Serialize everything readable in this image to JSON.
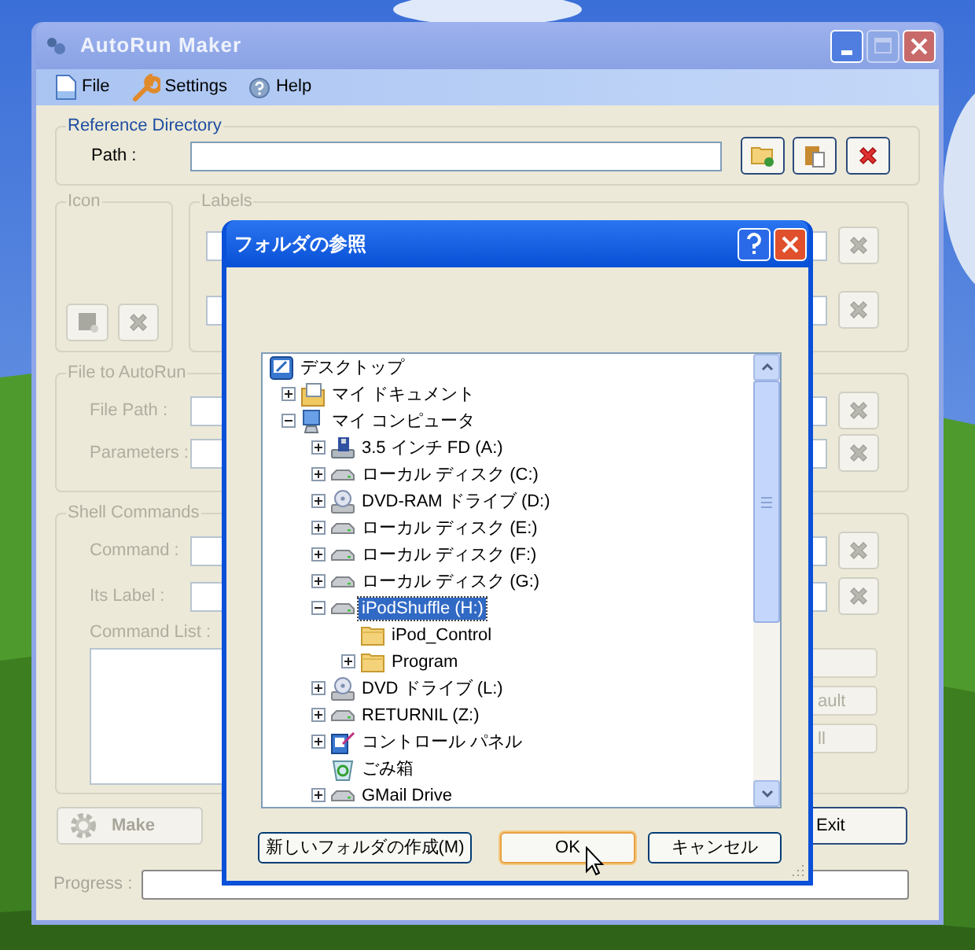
{
  "window": {
    "title": "AutoRun Maker",
    "menu": [
      {
        "label": "File",
        "kind": "file"
      },
      {
        "label": "Settings",
        "kind": "settings"
      },
      {
        "label": "Help",
        "kind": "help"
      }
    ]
  },
  "reference_directory": {
    "legend": "Reference Directory",
    "disabled": false,
    "path_label": "Path :"
  },
  "icon_group": {
    "legend": "Icon",
    "disabled": true
  },
  "labels_group": {
    "legend": "Labels",
    "disabled": true
  },
  "file_group": {
    "legend": "File to AutoRun",
    "disabled": true,
    "fields": [
      {
        "label": "File Path :"
      },
      {
        "label": "Parameters :"
      }
    ]
  },
  "shell_group": {
    "legend": "Shell Commands",
    "disabled": true,
    "fields": [
      {
        "label": "Command :"
      },
      {
        "label": "Its Label :"
      }
    ],
    "list_label": "Command List :",
    "side_buttons": [
      "ault",
      "ll"
    ]
  },
  "make_button": {
    "label": "Make",
    "disabled": true
  },
  "exit_button": {
    "label": "Exit"
  },
  "progress": {
    "label": "Progress :",
    "level": 0
  },
  "dialog": {
    "title": "フォルダの参照",
    "tree": [
      {
        "label": "デスクトップ",
        "kind": "desktop",
        "selected": false,
        "children": [
          {
            "label": "マイ ドキュメント",
            "kind": "documents",
            "expanded": false,
            "selected": false
          },
          {
            "label": "マイ コンピュータ",
            "kind": "computer",
            "expanded": true,
            "selected": false,
            "children": [
              {
                "label": "3.5 インチ FD (A:)",
                "kind": "floppy",
                "expanded": false,
                "selected": false
              },
              {
                "label": "ローカル ディスク (C:)",
                "kind": "drive",
                "expanded": false,
                "selected": false
              },
              {
                "label": "DVD-RAM ドライブ (D:)",
                "kind": "disc",
                "expanded": false,
                "selected": false
              },
              {
                "label": "ローカル ディスク (E:)",
                "kind": "drive",
                "expanded": false,
                "selected": false
              },
              {
                "label": "ローカル ディスク (F:)",
                "kind": "drive",
                "expanded": false,
                "selected": false
              },
              {
                "label": "ローカル ディスク (G:)",
                "kind": "drive",
                "expanded": false,
                "selected": false
              },
              {
                "label": "iPodShuffle (H:)",
                "kind": "drive",
                "expanded": true,
                "selected": true,
                "children": [
                  {
                    "label": "iPod_Control",
                    "kind": "folder",
                    "selected": false
                  },
                  {
                    "label": "Program",
                    "kind": "folder",
                    "expanded": false,
                    "selected": false
                  }
                ]
              },
              {
                "label": "DVD ドライブ (L:)",
                "kind": "disc",
                "expanded": false,
                "selected": false
              },
              {
                "label": "RETURNIL (Z:)",
                "kind": "drive",
                "expanded": false,
                "selected": false
              },
              {
                "label": "コントロール パネル",
                "kind": "control",
                "expanded": false,
                "selected": false
              },
              {
                "label": "ごみ箱",
                "kind": "recycle",
                "selected": false
              },
              {
                "label": "GMail Drive",
                "kind": "drive",
                "expanded": false,
                "selected": false
              }
            ]
          }
        ]
      }
    ],
    "buttons": [
      {
        "label": "新しいフォルダの作成(M)",
        "focused": false
      },
      {
        "label": "OK",
        "focused": true
      },
      {
        "label": "キャンセル",
        "focused": false
      }
    ]
  }
}
